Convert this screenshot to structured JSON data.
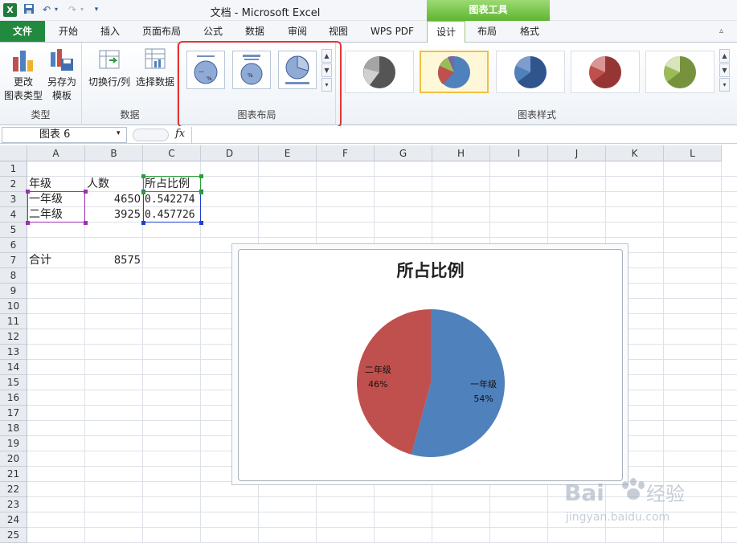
{
  "app": {
    "title": "文档 - Microsoft Excel",
    "context_header": "图表工具"
  },
  "tabs": [
    {
      "id": "file",
      "label": "文件"
    },
    {
      "id": "home",
      "label": "开始"
    },
    {
      "id": "insert",
      "label": "插入"
    },
    {
      "id": "page_layout",
      "label": "页面布局"
    },
    {
      "id": "formulas",
      "label": "公式"
    },
    {
      "id": "data",
      "label": "数据"
    },
    {
      "id": "review",
      "label": "审阅"
    },
    {
      "id": "view",
      "label": "视图"
    },
    {
      "id": "wps",
      "label": "WPS PDF"
    },
    {
      "id": "design",
      "label": "设计"
    },
    {
      "id": "layout",
      "label": "布局"
    },
    {
      "id": "format",
      "label": "格式"
    }
  ],
  "ribbon": {
    "type_group": {
      "label": "类型",
      "change_type": [
        "更改",
        "图表类型"
      ],
      "save_template": [
        "另存为",
        "模板"
      ]
    },
    "data_group": {
      "label": "数据",
      "switch_row_col": "切换行/列",
      "select_data": "选择数据"
    },
    "layout_group": {
      "label": "图表布局"
    },
    "styles_group": {
      "label": "图表样式"
    }
  },
  "formula_bar": {
    "name_box": "图表 6",
    "fx": "fx"
  },
  "columns": [
    "A",
    "B",
    "C",
    "D",
    "E",
    "F",
    "G",
    "H",
    "I",
    "J",
    "K",
    "L"
  ],
  "rows": [
    "1",
    "2",
    "3",
    "4",
    "5",
    "6",
    "7",
    "8",
    "9",
    "10",
    "11",
    "12",
    "13",
    "14",
    "15",
    "16",
    "17",
    "18",
    "19",
    "20",
    "21",
    "22",
    "23",
    "24",
    "25"
  ],
  "cells": {
    "A2": "年级",
    "B2": "人数",
    "C2": "所占比例",
    "A3": "一年级",
    "B3": "4650",
    "C3": "0.542274",
    "A4": "二年级",
    "B4": "3925",
    "C4": "0.457726",
    "A7": "合计",
    "B7": "8575"
  },
  "chart_data": {
    "type": "pie",
    "title": "所占比例",
    "categories": [
      "一年级",
      "二年级"
    ],
    "values": [
      0.542274,
      0.457726
    ],
    "labels": [
      "54%",
      "46%"
    ],
    "colors": [
      "#4f81bd",
      "#c0504d"
    ]
  },
  "watermark": {
    "brand": "Baidu经验",
    "url": "jingyan.baidu.com"
  }
}
